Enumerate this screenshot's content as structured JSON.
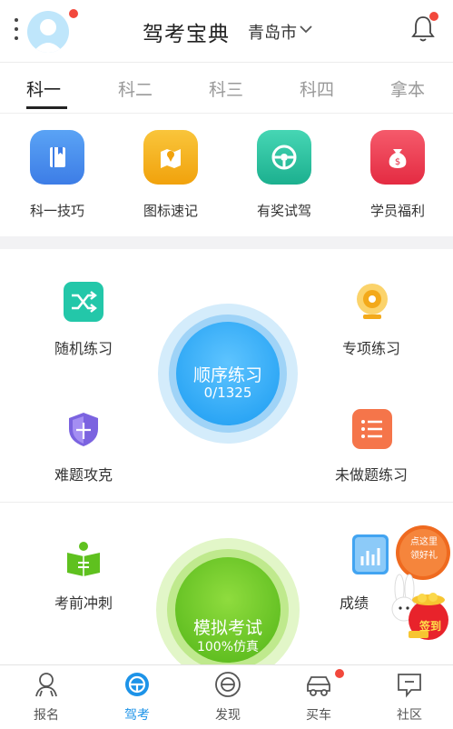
{
  "header": {
    "title": "驾考宝典",
    "city": "青岛市"
  },
  "tabs": [
    {
      "label": "科一"
    },
    {
      "label": "科二"
    },
    {
      "label": "科三"
    },
    {
      "label": "科四"
    },
    {
      "label": "拿本"
    }
  ],
  "features": [
    {
      "label": "科一技巧",
      "icon": "book-icon",
      "color": "#4a8ff0"
    },
    {
      "label": "图标速记",
      "icon": "map-pin-icon",
      "color": "#f5b21f"
    },
    {
      "label": "有奖试驾",
      "icon": "steering-wheel-icon",
      "color": "#2cc2a3"
    },
    {
      "label": "学员福利",
      "icon": "money-bag-icon",
      "color": "#ee4256"
    }
  ],
  "practice": {
    "random": "随机练习",
    "special": "专项练习",
    "hard": "难题攻克",
    "undone": "未做题练习",
    "sequential": {
      "label": "顺序练习",
      "progress": "0/1325"
    }
  },
  "exam": {
    "prep": "考前冲刺",
    "score": "成绩",
    "mock": {
      "label": "模拟考试",
      "sub": "100%仿真"
    }
  },
  "promo": {
    "text_top": "点这里",
    "text_mid": "领好礼",
    "sign": "签到"
  },
  "bottom_nav": [
    {
      "label": "报名",
      "icon": "signup-icon"
    },
    {
      "label": "驾考",
      "icon": "steering-wheel-icon"
    },
    {
      "label": "发现",
      "icon": "discover-icon"
    },
    {
      "label": "买车",
      "icon": "car-icon"
    },
    {
      "label": "社区",
      "icon": "community-icon"
    }
  ],
  "colors": {
    "accent_blue": "#1d93e8",
    "accent_green": "#5fc11f",
    "badge_red": "#f2483c"
  }
}
